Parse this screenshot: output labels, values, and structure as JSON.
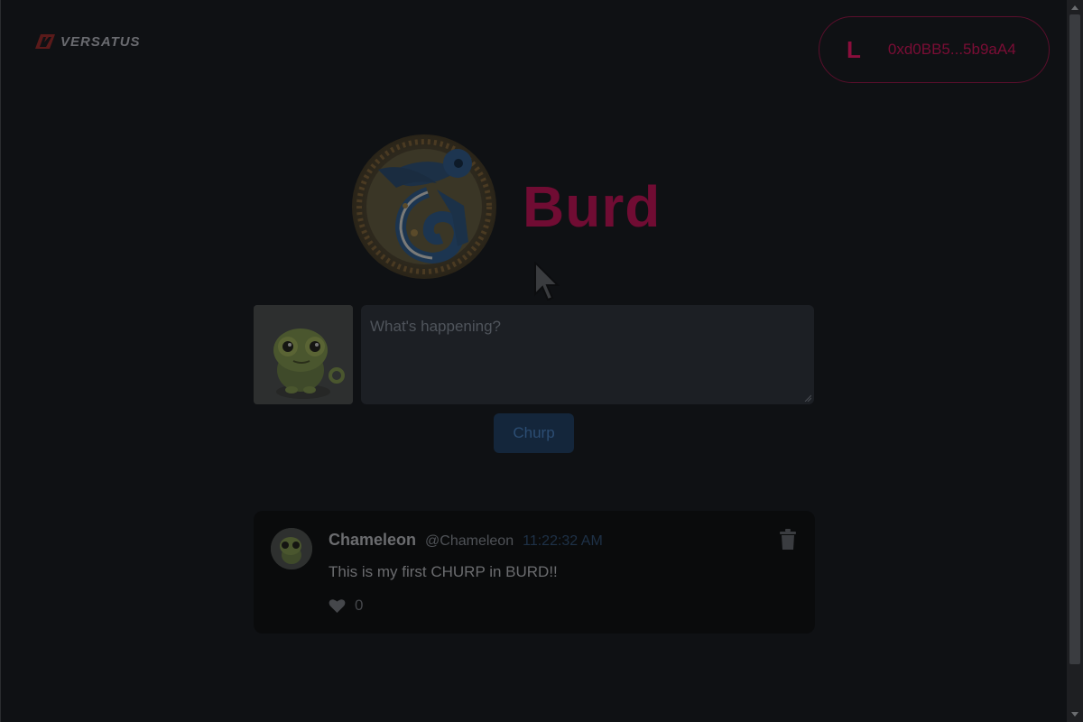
{
  "brand": {
    "logo_text": "VERSATUS"
  },
  "wallet": {
    "initial": "L",
    "address": "0xd0BB5...5b9aA4"
  },
  "hero": {
    "title": "Burd"
  },
  "composer": {
    "placeholder": "What's happening?",
    "value": "",
    "submit_label": "Churp"
  },
  "feed": {
    "posts": [
      {
        "name": "Chameleon",
        "handle": "@Chameleon",
        "time": "11:22:32 AM",
        "body": "This is my first CHURP in BURD!!",
        "likes": "0"
      }
    ]
  },
  "icons": {
    "logo": "versatus-logo-icon",
    "hero": "chameleon-emblem-icon",
    "like": "heart-icon",
    "delete": "trash-icon",
    "cursor": "mouse-pointer-icon"
  },
  "colors": {
    "accent": "#700c33",
    "button": "#14263b",
    "background": "#0f1114"
  }
}
